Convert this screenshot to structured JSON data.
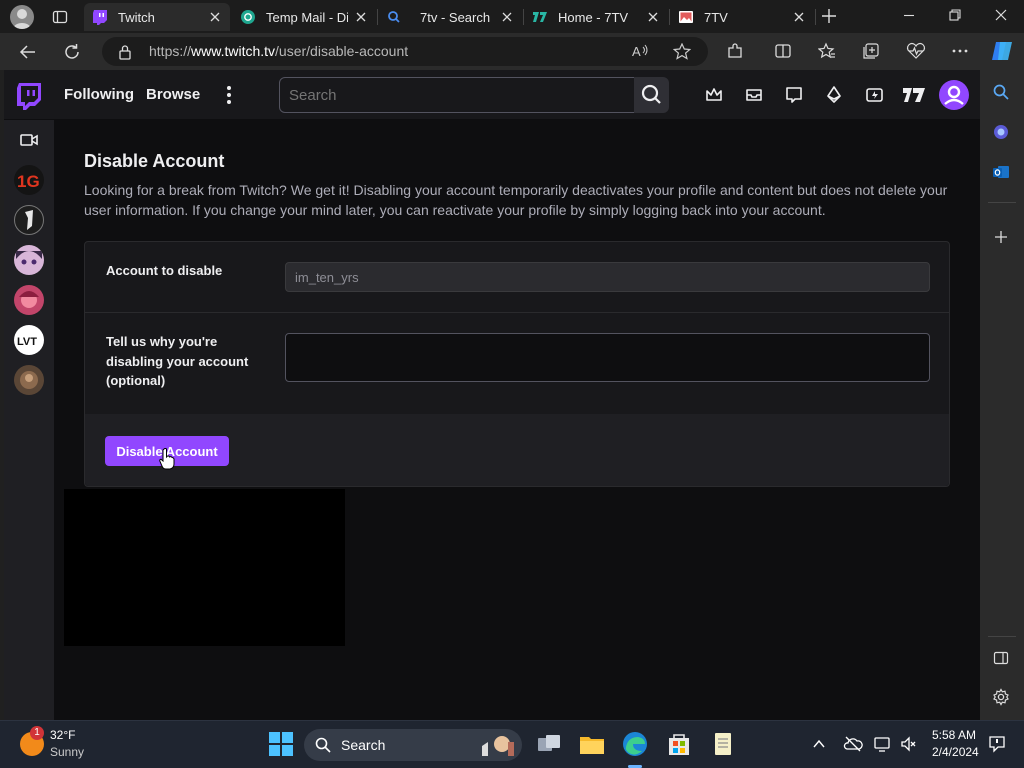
{
  "browser": {
    "tabs": [
      {
        "title": "Twitch",
        "active": true
      },
      {
        "title": "Temp Mail - Di",
        "active": false
      },
      {
        "title": "7tv - Search",
        "active": false
      },
      {
        "title": "Home - 7TV",
        "active": false
      },
      {
        "title": "7TV",
        "active": false
      }
    ],
    "url_prefix": "https://",
    "url_host": "www.twitch.tv",
    "url_path": "/user/disable-account"
  },
  "twitch_nav": {
    "following": "Following",
    "browse": "Browse",
    "search_placeholder": "Search"
  },
  "page": {
    "title": "Disable Account",
    "description": "Looking for a break from Twitch? We get it! Disabling your account temporarily deactivates your profile and content but does not delete your user information. If you change your mind later, you can reactivate your profile by simply logging back into your account.",
    "account_label": "Account to disable",
    "account_value": "im_ten_yrs",
    "reason_label_1": "Tell us why you're",
    "reason_label_2": "disabling your account",
    "reason_label_3": "(optional)",
    "reason_value": "",
    "disable_button": "Disable Account"
  },
  "taskbar": {
    "weather_badge": "1",
    "temperature": "32°F",
    "condition": "Sunny",
    "search_placeholder": "Search",
    "time": "5:58 AM",
    "date": "2/4/2024"
  },
  "colors": {
    "twitch_purple": "#9147ff",
    "page_bg": "#0e0e10",
    "nav_bg": "#18181b"
  }
}
